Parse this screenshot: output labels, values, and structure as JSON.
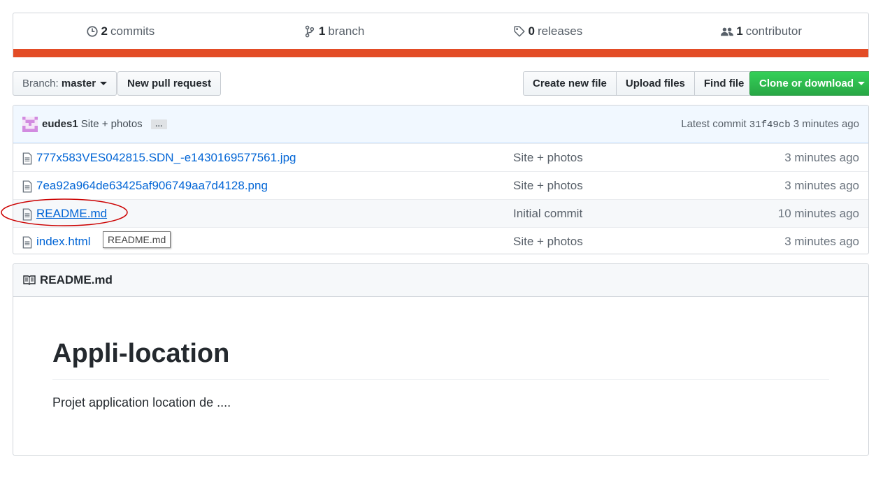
{
  "stats": {
    "commits": {
      "count": "2",
      "label": "commits"
    },
    "branches": {
      "count": "1",
      "label": "branch"
    },
    "releases": {
      "count": "0",
      "label": "releases"
    },
    "contributors": {
      "count": "1",
      "label": "contributor"
    },
    "language_color": "#e34c26"
  },
  "toolbar": {
    "branch_prefix": "Branch:",
    "branch_name": "master",
    "new_pull_request": "New pull request",
    "create_new_file": "Create new file",
    "upload_files": "Upload files",
    "find_file": "Find file",
    "clone_or_download": "Clone or download"
  },
  "commit": {
    "author": "eudes1",
    "message": "Site + photos",
    "ellipsis": "…",
    "latest_label": "Latest commit",
    "sha": "31f49cb",
    "age": "3 minutes ago"
  },
  "files": [
    {
      "name": "777x583VES042815.SDN_-e1430169577561.jpg",
      "message": "Site + photos",
      "age": "3 minutes ago"
    },
    {
      "name": "7ea92a964de63425af906749aa7d4128.png",
      "message": "Site + photos",
      "age": "3 minutes ago"
    },
    {
      "name": "README.md",
      "message": "Initial commit",
      "age": "10 minutes ago"
    },
    {
      "name": "index.html",
      "message": "Site + photos",
      "age": "3 minutes ago"
    }
  ],
  "tooltip": "README.md",
  "readme": {
    "header": "README.md",
    "title": "Appli-location",
    "body": "Projet application location de ...."
  },
  "colors": {
    "link": "#0366d6",
    "green": "#28a745",
    "annotation": "#cc0000"
  }
}
